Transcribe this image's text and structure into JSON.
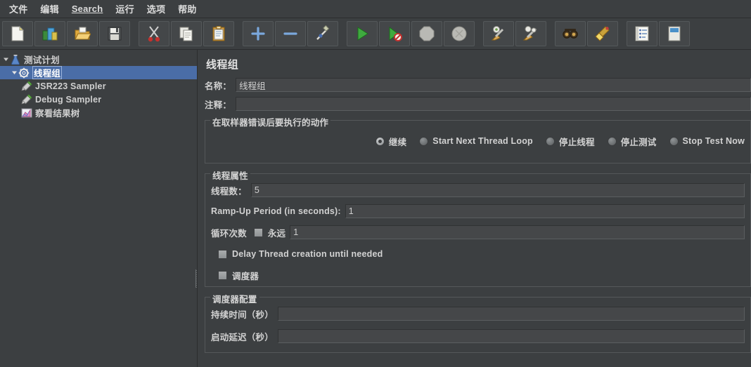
{
  "menubar": {
    "items": [
      {
        "label": "文件"
      },
      {
        "label": "编辑"
      },
      {
        "label": "Search",
        "mnemonic": "S"
      },
      {
        "label": "运行"
      },
      {
        "label": "选项"
      },
      {
        "label": "帮助"
      }
    ]
  },
  "toolbar": {
    "buttons": [
      {
        "name": "new-icon",
        "tip": "新建"
      },
      {
        "name": "templates-icon",
        "tip": "模板"
      },
      {
        "name": "open-icon",
        "tip": "打开"
      },
      {
        "name": "save-icon",
        "tip": "保存"
      },
      {
        "name": "cut-icon",
        "tip": "剪切"
      },
      {
        "name": "copy-icon",
        "tip": "复制"
      },
      {
        "name": "paste-icon",
        "tip": "粘贴"
      },
      {
        "name": "expand-all-icon",
        "tip": "展开全部"
      },
      {
        "name": "collapse-all-icon",
        "tip": "折叠全部"
      },
      {
        "name": "toggle-icon",
        "tip": "切换"
      },
      {
        "name": "start-icon",
        "tip": "启动"
      },
      {
        "name": "start-no-pauses-icon",
        "tip": "无间隔启动"
      },
      {
        "name": "stop-icon",
        "tip": "停止"
      },
      {
        "name": "shutdown-icon",
        "tip": "关闭"
      },
      {
        "name": "clear-icon",
        "tip": "清除"
      },
      {
        "name": "clear-all-icon",
        "tip": "清除全部"
      },
      {
        "name": "search-icon",
        "tip": "搜索"
      },
      {
        "name": "search-reset-icon",
        "tip": "重置搜索"
      },
      {
        "name": "function-helper-icon",
        "tip": "函数助手对话框"
      },
      {
        "name": "help-icon",
        "tip": "帮助"
      }
    ]
  },
  "tree": {
    "nodes": [
      {
        "label": "测试计划",
        "icon": "test-plan-icon",
        "depth": 1,
        "expanded": true,
        "selected": false
      },
      {
        "label": "线程组",
        "icon": "thread-group-icon",
        "depth": 2,
        "expanded": true,
        "selected": true
      },
      {
        "label": "JSR223 Sampler",
        "icon": "sampler-icon",
        "depth": 3,
        "expanded": null,
        "selected": false
      },
      {
        "label": "Debug Sampler",
        "icon": "sampler-icon",
        "depth": 3,
        "expanded": null,
        "selected": false
      },
      {
        "label": "察看结果树",
        "icon": "view-results-tree-icon",
        "depth": 3,
        "expanded": null,
        "selected": false
      }
    ]
  },
  "panel": {
    "title": "线程组",
    "name_label": "名称：",
    "name_value": "线程组",
    "comment_label": "注释：",
    "comment_value": "",
    "on_error": {
      "group_title": "在取样器错误后要执行的动作",
      "options": [
        {
          "label": "继续",
          "selected": true
        },
        {
          "label": "Start Next Thread Loop",
          "selected": false
        },
        {
          "label": "停止线程",
          "selected": false
        },
        {
          "label": "停止测试",
          "selected": false
        },
        {
          "label": "Stop Test Now",
          "selected": false
        }
      ]
    },
    "thread_properties": {
      "group_title": "线程属性",
      "num_threads_label": "线程数：",
      "num_threads_value": "5",
      "ramp_up_label": "Ramp-Up Period (in seconds):",
      "ramp_up_value": "1",
      "loop_count_label": "循环次数",
      "forever_label": "永远",
      "forever_checked": false,
      "loop_count_value": "1",
      "delay_thread_label": "Delay Thread creation until needed",
      "delay_thread_checked": false,
      "scheduler_label": "调度器",
      "scheduler_checked": false
    },
    "scheduler_config": {
      "group_title": "调度器配置",
      "duration_label": "持续时间（秒）",
      "duration_value": "",
      "startup_delay_label": "启动延迟（秒）",
      "startup_delay_value": ""
    }
  },
  "colors": {
    "window_bg": "#3c3f41",
    "selection_blue": "#4a6da7",
    "text": "#d2d2d2",
    "border": "#55585a",
    "field_bg": "#454749"
  }
}
